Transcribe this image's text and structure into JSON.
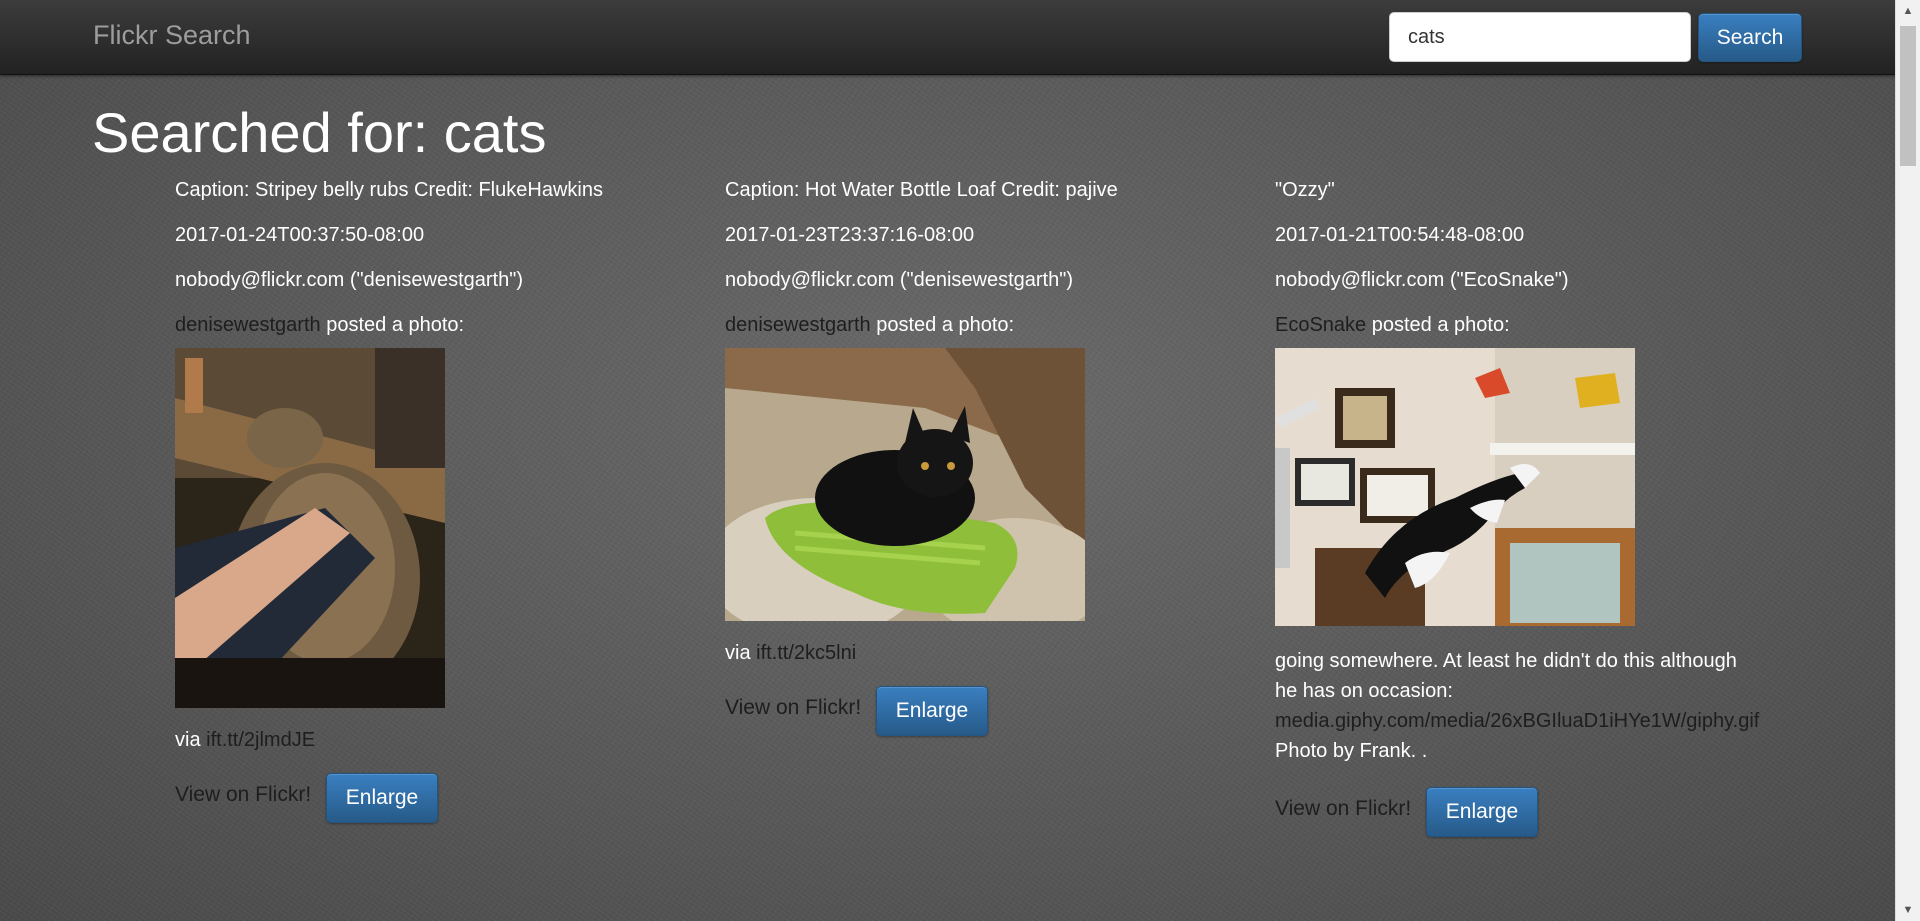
{
  "navbar": {
    "brand": "Flickr Search",
    "search_value": "cats",
    "search_button": "Search"
  },
  "page_title": "Searched for: cats",
  "posts": [
    {
      "caption": "Caption: Stripey belly rubs Credit: FlukeHawkins",
      "date": "2017-01-24T00:37:50-08:00",
      "author": "nobody@flickr.com (\"denisewestgarth\")",
      "user": "denisewestgarth",
      "posted_text": "posted a photo:",
      "image_description": "tabby cat lying on its back being petted",
      "via_label": "via",
      "via_link": "ift.tt/2jlmdJE",
      "view_label": "View on Flickr!",
      "enlarge_label": "Enlarge"
    },
    {
      "caption": "Caption: Hot Water Bottle Loaf Credit: pajive",
      "date": "2017-01-23T23:37:16-08:00",
      "author": "nobody@flickr.com (\"denisewestgarth\")",
      "user": "denisewestgarth",
      "posted_text": "posted a photo:",
      "image_description": "black kitten sitting on green hot water bottle",
      "via_label": "via",
      "via_link": "ift.tt/2kc5lni",
      "view_label": "View on Flickr!",
      "enlarge_label": "Enlarge"
    },
    {
      "caption": "\"Ozzy\"",
      "date": "2017-01-21T00:54:48-08:00",
      "author": "nobody@flickr.com (\"EcoSnake\")",
      "user": "EcoSnake",
      "posted_text": "posted a photo:",
      "image_description": "black and white cat leaping onto a shelf",
      "desc_line1": "going somewhere. At least he didn't do this although",
      "desc_line2": "he has on occasion:",
      "desc_link": "media.giphy.com/media/26xBGIluaD1iHYe1W/giphy.gif",
      "desc_line4": "Photo by Frank. .",
      "view_label": "View on Flickr!",
      "enlarge_label": "Enlarge"
    }
  ],
  "colors": {
    "navbar": "#2a2a2a",
    "brand": "#9d9d9d",
    "button": "#2f6ea5",
    "link": "#1e1e1e"
  }
}
